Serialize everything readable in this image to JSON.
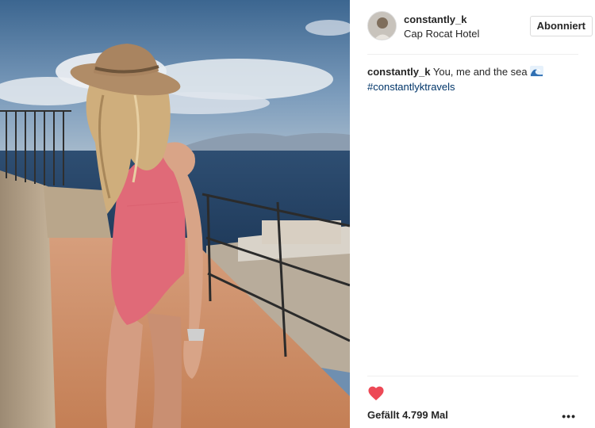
{
  "post": {
    "image_alt": "Woman in pink swimsuit and straw hat by the sea"
  },
  "header": {
    "username": "constantly_k",
    "location": "Cap Rocat Hotel",
    "follow_label": "Abonniert"
  },
  "caption": {
    "username": "constantly_k",
    "text": " You, me and the sea ",
    "hashtag": "#constantlyktravels"
  },
  "footer": {
    "likes": "Gefällt 4.799 Mal",
    "more_label": "•••"
  },
  "colors": {
    "heart": "#ed4956",
    "hashtag": "#003569",
    "swimsuit": "#e06a78"
  },
  "icons": [
    "heart-icon",
    "more-icon",
    "wave-icon"
  ]
}
